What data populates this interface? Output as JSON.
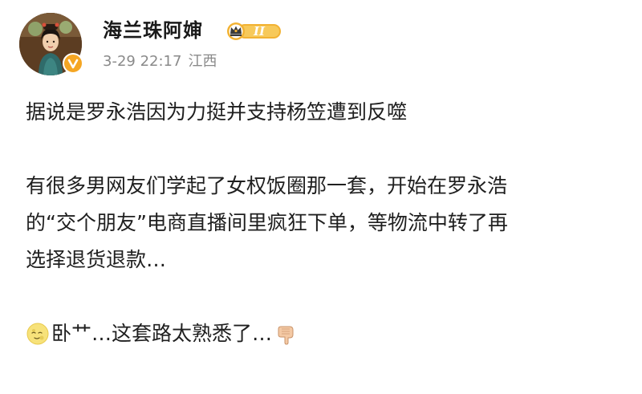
{
  "user": {
    "name": "海兰珠阿婶",
    "vip_level": "II",
    "date": "3-29 22:17",
    "location": "江西"
  },
  "post": {
    "paragraph1": "据说是罗永浩因为力挺并支持杨笠遭到反噬",
    "paragraph2_lines": [
      "有很多男网友们学起了女权饭圈那一套，开始在罗永浩",
      "的“交个朋友”电商直播间里疯狂下单，等物流中转了再",
      "选择退货退款…"
    ],
    "paragraph3_text": "卧艹…这套路太熟悉了…",
    "emojis": [
      "moon-face-icon",
      "pointing-hand-icon"
    ]
  },
  "colors": {
    "text": "#1f1f1f",
    "meta": "#8a8a8a",
    "vip_gold": "#f2b233",
    "verified": "#f5a623"
  }
}
